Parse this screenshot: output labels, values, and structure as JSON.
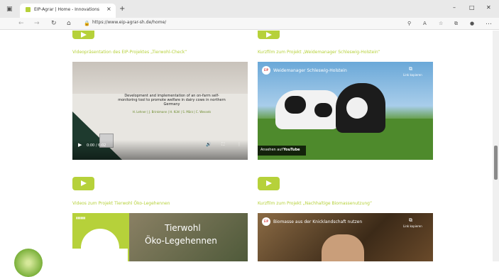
{
  "browser": {
    "tab_title": "EIP-Agrar | Home - Innovations",
    "url": "https://www.eip-agrar-sh.de/home/",
    "new_tab_symbol": "+",
    "close_symbol": "×",
    "win_min": "–",
    "win_max": "□",
    "win_close": "✕"
  },
  "videos": [
    {
      "heading": "Videopräsentation des EIP-Projektes „Tierwohl-Check“"
    },
    {
      "heading": "Kurzfilm zum Projekt „Weidemanager Schleswig-Holstein“",
      "title": "Weidemanager Schleswig-Holstein",
      "watch_on": "Ansehen auf",
      "youtube": "YouTube",
      "share": "Link kopieren"
    },
    {
      "heading": "Videos zum Projekt Tierwohl Öko-Legehennen",
      "overlay_line1": "Tierwohl",
      "overlay_line2": "Öko-Legehennen"
    },
    {
      "heading": "Kurzfilm zum Projekt „Nachhaltige Biomassenutzung“",
      "title": "Biomasse aus der Knicklandschaft nutzen",
      "share": "Link kopieren"
    }
  ],
  "slide": {
    "title": "Development and implementation of an on-farm self-monitoring tool to promote welfare in dairy cows in northern Germany",
    "authors": "H. Lehner | J. Brinkmann | H. Kühl | S. März | C. Wessels",
    "time": "0:00 / 6:02"
  },
  "colors": {
    "accent": "#b6d13a"
  }
}
